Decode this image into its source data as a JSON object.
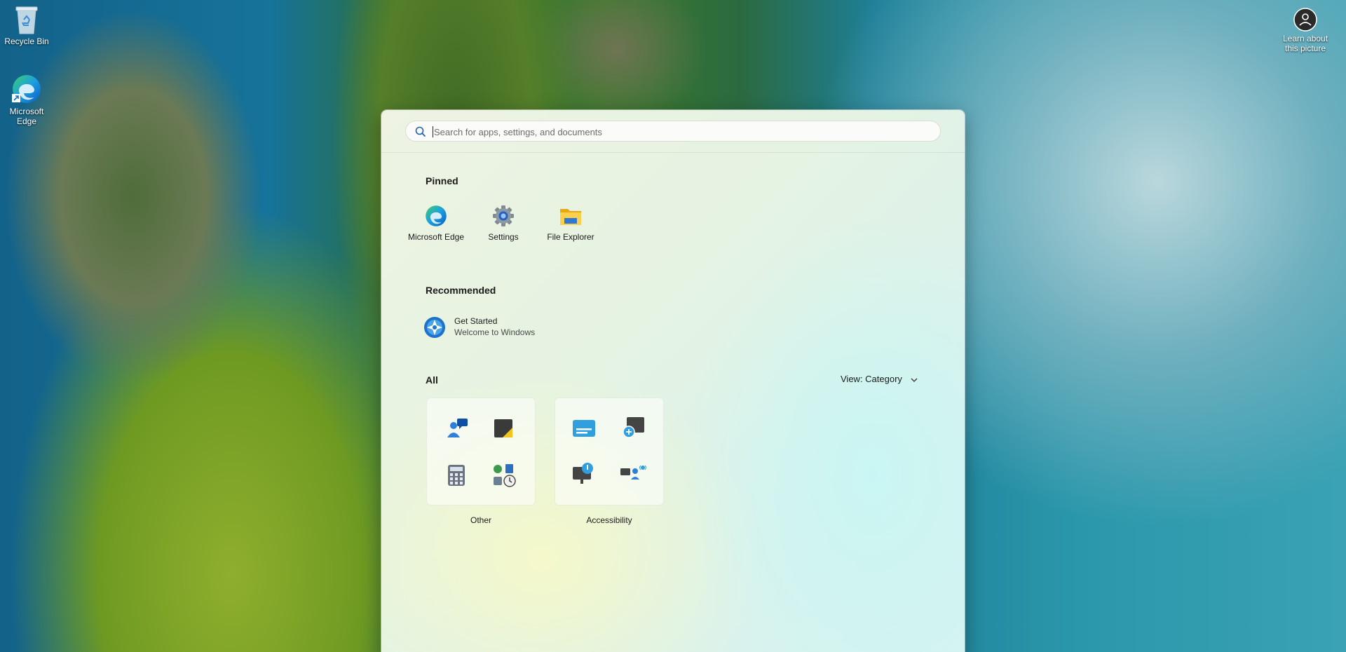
{
  "desktop": {
    "icons": [
      {
        "label": "Recycle Bin"
      },
      {
        "label": "Microsoft Edge"
      }
    ],
    "learn_picture_label": "Learn about this picture"
  },
  "start_menu": {
    "search": {
      "placeholder": "Search for apps, settings, and documents",
      "value": ""
    },
    "pinned": {
      "title": "Pinned",
      "apps": [
        {
          "label": "Microsoft Edge",
          "icon": "edge-icon"
        },
        {
          "label": "Settings",
          "icon": "settings-gear-icon"
        },
        {
          "label": "File Explorer",
          "icon": "folder-icon"
        }
      ]
    },
    "recommended": {
      "title": "Recommended",
      "items": [
        {
          "title": "Get Started",
          "subtitle": "Welcome to Windows",
          "icon": "get-started-icon"
        }
      ]
    },
    "all": {
      "title": "All",
      "view_label": "View: Category",
      "categories": [
        {
          "label": "Other",
          "icons": [
            "people-chat-icon",
            "sticky-notes-icon",
            "calculator-icon",
            "clock-tools-icon"
          ]
        },
        {
          "label": "Accessibility",
          "icons": [
            "live-captions-icon",
            "magnifier-icon",
            "narrator-icon",
            "voice-access-icon"
          ]
        }
      ]
    }
  }
}
